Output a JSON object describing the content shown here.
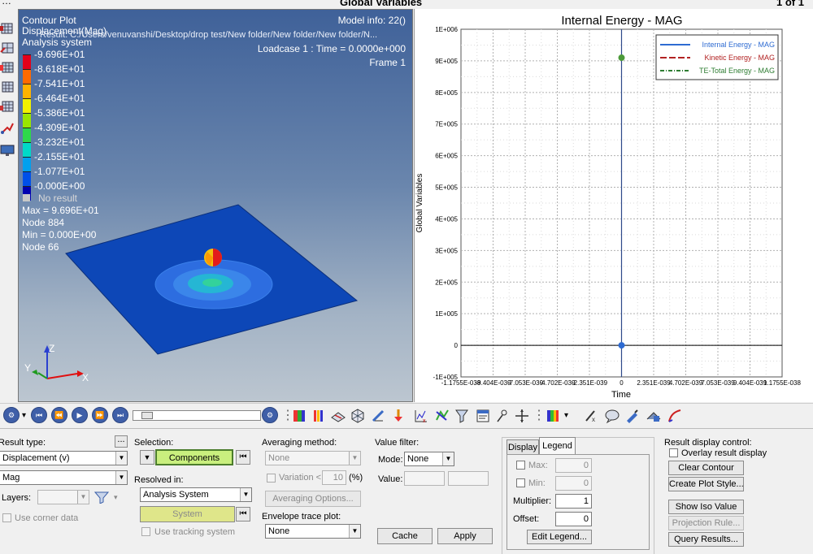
{
  "window": {
    "title": "Global Variables",
    "page": "1 of 1"
  },
  "viewport": {
    "contour_title": "Contour Plot",
    "result_name": "Displacement(Mag)",
    "coord_system": "Analysis system",
    "file_path": "Result: C:/Users/venuvanshi/Desktop/drop test/New folder/New folder/New folder/N...",
    "model_info": "Model info: 22()",
    "loadcase": "Loadcase 1 : Time = 0.0000e+000",
    "frame": "Frame 1",
    "legend_values": [
      "9.696E+01",
      "8.618E+01",
      "7.541E+01",
      "6.464E+01",
      "5.386E+01",
      "4.309E+01",
      "3.232E+01",
      "2.155E+01",
      "1.077E+01",
      "0.000E+00"
    ],
    "legend_colors": [
      "#e3001a",
      "#ff6a00",
      "#ffb300",
      "#f2f200",
      "#99e600",
      "#2ed84a",
      "#00d9c8",
      "#00a0ee",
      "#0050e8",
      "#0000b0"
    ],
    "no_result": "No result",
    "max_text": "Max = 9.696E+01",
    "max_node": "Node 884",
    "min_text": "Min = 0.000E+00",
    "min_node": "Node 66",
    "axis_x": "X",
    "axis_y": "Y",
    "axis_z": "Z"
  },
  "chart_data": {
    "type": "line",
    "title": "Internal Energy - MAG",
    "xlabel": "Time",
    "ylabel": "Global Variables",
    "x_ticks": [
      "-1.1755E-038",
      "-9.404E-039",
      "-7.053E-039",
      "-4.702E-039",
      "-2.351E-039",
      "0",
      "2.351E-039",
      "4.702E-039",
      "7.053E-039",
      "9.404E-039",
      "1.1755E-038"
    ],
    "y_ticks": [
      "-1E+005",
      "0",
      "1E+005",
      "2E+005",
      "3E+005",
      "4E+005",
      "5E+005",
      "6E+005",
      "7E+005",
      "8E+005",
      "9E+005",
      "1E+006"
    ],
    "ylim": [
      -100000,
      1000000
    ],
    "grid": true,
    "legend_position": "top-right",
    "series": [
      {
        "name": "Internal Energy - MAG",
        "color": "#2e6bd2",
        "style": "solid",
        "x": [
          0
        ],
        "y": [
          0
        ]
      },
      {
        "name": "Kinetic Energy - MAG",
        "color": "#b22222",
        "style": "dashed",
        "x": [
          0
        ],
        "y": [
          910000
        ]
      },
      {
        "name": "TE-Total Energy - MAG",
        "color": "#2e7d32",
        "style": "dashdot",
        "x": [
          0
        ],
        "y": [
          910000
        ]
      }
    ]
  },
  "panel": {
    "result_type_label": "Result type:",
    "result_type_value": "Displacement (v)",
    "component_value": "Mag",
    "layers_label": "Layers:",
    "use_corner_data": "Use corner data",
    "selection_label": "Selection:",
    "components_btn": "Components",
    "resolved_in_label": "Resolved in:",
    "resolved_value": "Analysis System",
    "system_btn": "System",
    "use_tracking": "Use tracking system",
    "averaging_label": "Averaging method:",
    "averaging_value": "None",
    "variation_label": "Variation <",
    "variation_value": "10",
    "variation_unit": "(%)",
    "averaging_options_btn": "Averaging Options...",
    "envelope_label": "Envelope trace plot:",
    "envelope_value": "None",
    "value_filter_label": "Value filter:",
    "mode_label": "Mode:",
    "mode_value": "None",
    "value_label": "Value:",
    "cache_btn": "Cache",
    "apply_btn": "Apply",
    "tab_display": "Display",
    "tab_legend": "Legend",
    "max_label": "Max:",
    "max_value": "0",
    "min_label": "Min:",
    "min_value": "0",
    "multiplier_label": "Multiplier:",
    "multiplier_value": "1",
    "offset_label": "Offset:",
    "offset_value": "0",
    "edit_legend_btn": "Edit Legend...",
    "result_display_label": "Result display control:",
    "overlay_label": "Overlay result display",
    "clear_contour_btn": "Clear Contour",
    "create_plot_style_btn": "Create Plot Style...",
    "show_iso_btn": "Show Iso Value",
    "projection_rule_btn": "Projection Rule...",
    "query_results_btn": "Query Results..."
  }
}
